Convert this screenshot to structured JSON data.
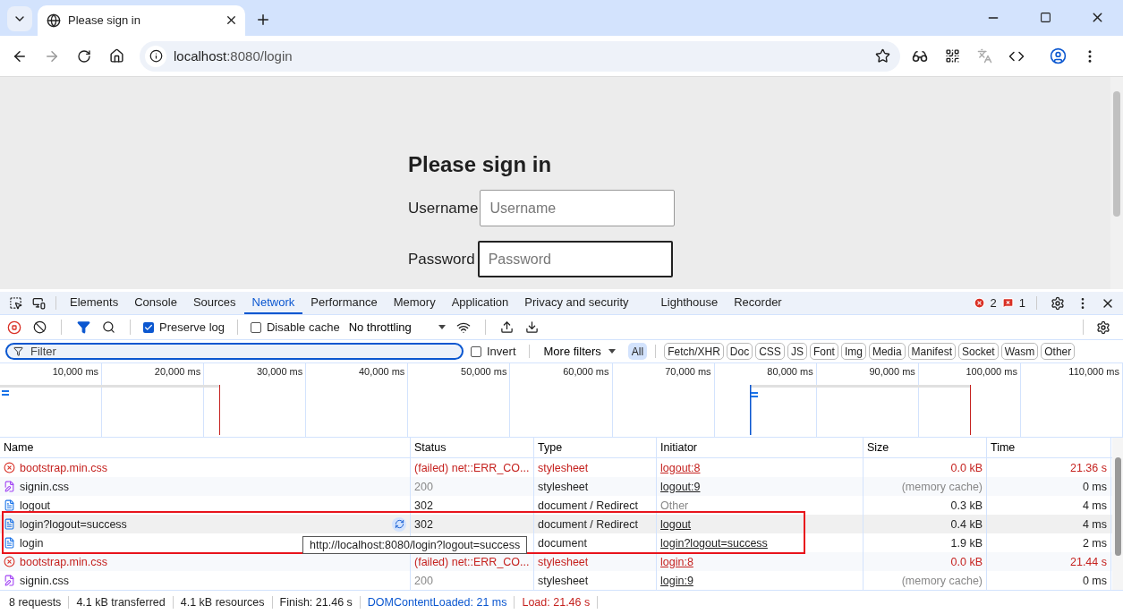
{
  "browser": {
    "tab_title": "Please sign in",
    "url_host": "localhost",
    "url_path": ":8080/login"
  },
  "page": {
    "heading": "Please sign in",
    "fields": [
      {
        "label": "Username",
        "placeholder": "Username",
        "focused": false
      },
      {
        "label": "Password",
        "placeholder": "Password",
        "focused": true
      }
    ]
  },
  "devtools": {
    "tabs": [
      {
        "label": "Elements",
        "selected": false
      },
      {
        "label": "Console",
        "selected": false
      },
      {
        "label": "Sources",
        "selected": false
      },
      {
        "label": "Network",
        "selected": true
      },
      {
        "label": "Performance",
        "selected": false
      },
      {
        "label": "Memory",
        "selected": false
      },
      {
        "label": "Application",
        "selected": false
      },
      {
        "label": "Privacy and security",
        "selected": false
      },
      {
        "label": "Lighthouse",
        "selected": false
      },
      {
        "label": "Recorder",
        "selected": false
      }
    ],
    "error_count": "2",
    "issue_count": "1",
    "toolbar": {
      "preserve_log": {
        "label": "Preserve log",
        "checked": true
      },
      "disable_cache": {
        "label": "Disable cache",
        "checked": false
      },
      "throttling": "No throttling"
    },
    "filter": {
      "placeholder": "Filter",
      "invert": {
        "label": "Invert",
        "checked": false
      },
      "more_filters": "More filters",
      "types": [
        {
          "label": "All",
          "selected": true
        },
        {
          "label": "Fetch/XHR",
          "selected": false
        },
        {
          "label": "Doc",
          "selected": false
        },
        {
          "label": "CSS",
          "selected": false
        },
        {
          "label": "JS",
          "selected": false
        },
        {
          "label": "Font",
          "selected": false
        },
        {
          "label": "Img",
          "selected": false
        },
        {
          "label": "Media",
          "selected": false
        },
        {
          "label": "Manifest",
          "selected": false
        },
        {
          "label": "Socket",
          "selected": false
        },
        {
          "label": "Wasm",
          "selected": false
        },
        {
          "label": "Other",
          "selected": false
        }
      ]
    },
    "overview_ticks": [
      "10,000 ms",
      "20,000 ms",
      "30,000 ms",
      "40,000 ms",
      "50,000 ms",
      "60,000 ms",
      "70,000 ms",
      "80,000 ms",
      "90,000 ms",
      "100,000 ms",
      "110,000 ms"
    ],
    "table": {
      "columns": [
        "Name",
        "Status",
        "Type",
        "Initiator",
        "Size",
        "Time"
      ],
      "rows": [
        {
          "kind": "failed",
          "name": "bootstrap.min.css",
          "status": "(failed) net::ERR_CO...",
          "type": "stylesheet",
          "initiator": "logout:8",
          "initiator_link": true,
          "size": "0.0 kB",
          "time": "21.36 s",
          "cached": false,
          "hovered": false,
          "highlighted": false
        },
        {
          "kind": "stylesheet",
          "name": "signin.css",
          "status": "200",
          "type": "stylesheet",
          "initiator": "logout:9",
          "initiator_link": true,
          "size": "(memory cache)",
          "time": "0 ms",
          "cached": true,
          "hovered": false,
          "highlighted": false
        },
        {
          "kind": "document",
          "name": "logout",
          "status": "302",
          "type": "document / Redirect",
          "initiator": "Other",
          "initiator_link": false,
          "size": "0.3 kB",
          "time": "4 ms",
          "cached": false,
          "hovered": false,
          "highlighted": false
        },
        {
          "kind": "document",
          "name": "login?logout=success",
          "status": "302",
          "type": "document / Redirect",
          "initiator": "logout",
          "initiator_link": true,
          "size": "0.4 kB",
          "time": "4 ms",
          "cached": false,
          "hovered": true,
          "highlighted": true
        },
        {
          "kind": "document",
          "name": "login",
          "type": "document",
          "initiator": "login?logout=success",
          "initiator_link": true,
          "size": "1.9 kB",
          "time": "2 ms",
          "cached": false,
          "hovered": false,
          "highlighted": true
        },
        {
          "kind": "failed",
          "name": "bootstrap.min.css",
          "status": "(failed) net::ERR_CO...",
          "type": "stylesheet",
          "initiator": "login:8",
          "initiator_link": true,
          "size": "0.0 kB",
          "time": "21.44 s",
          "cached": false,
          "hovered": false,
          "highlighted": false
        },
        {
          "kind": "stylesheet",
          "name": "signin.css",
          "status": "200",
          "type": "stylesheet",
          "initiator": "login:9",
          "initiator_link": true,
          "size": "(memory cache)",
          "time": "0 ms",
          "cached": true,
          "hovered": false,
          "highlighted": false
        }
      ],
      "tooltip": "http://localhost:8080/login?logout=success"
    },
    "status_bar": [
      {
        "kind": "plain",
        "text": "8 requests"
      },
      {
        "kind": "plain",
        "text": "4.1 kB transferred"
      },
      {
        "kind": "plain",
        "text": "4.1 kB resources"
      },
      {
        "kind": "plain",
        "text": "Finish: 21.46 s"
      },
      {
        "kind": "dom",
        "text": "DOMContentLoaded: 21 ms"
      },
      {
        "kind": "load",
        "text": "Load: 21.46 s"
      }
    ]
  }
}
